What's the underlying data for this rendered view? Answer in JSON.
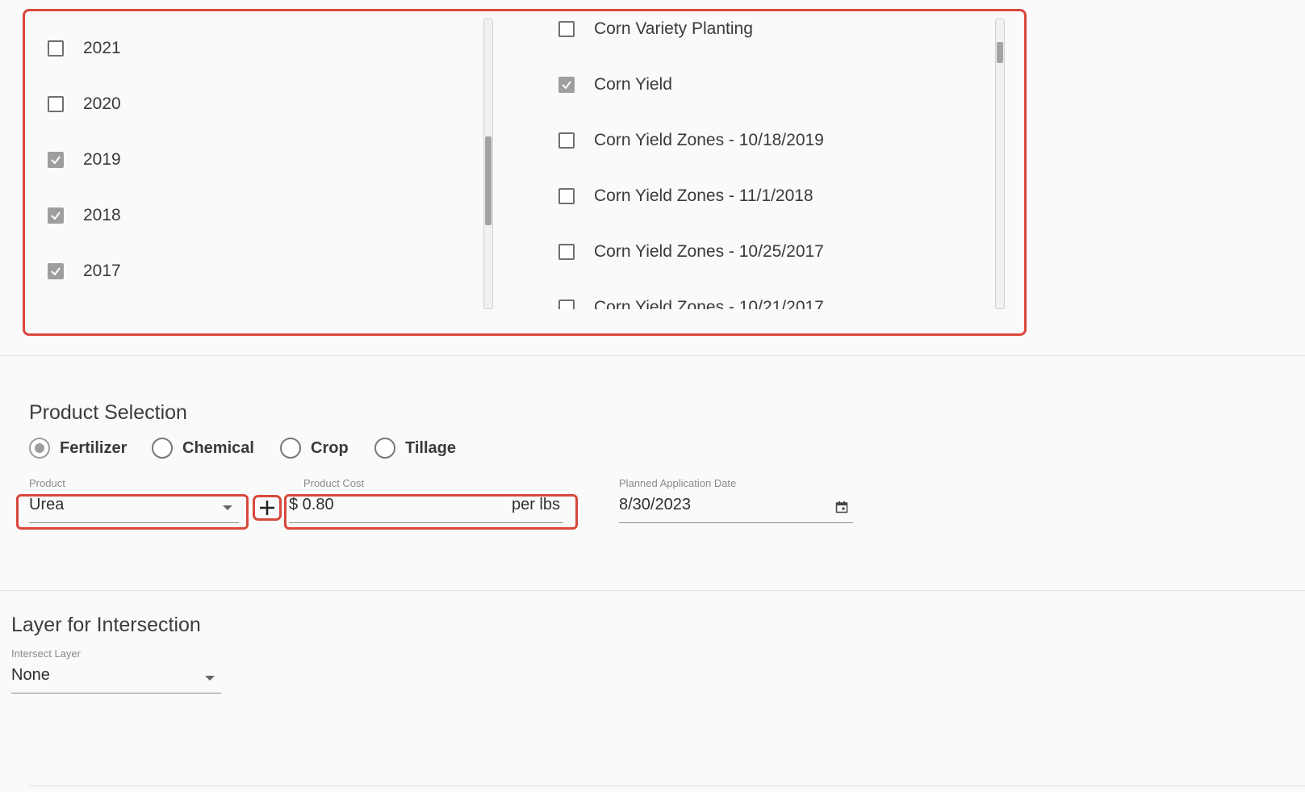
{
  "years": [
    {
      "label": "2021",
      "checked": false
    },
    {
      "label": "2020",
      "checked": false
    },
    {
      "label": "2019",
      "checked": true
    },
    {
      "label": "2018",
      "checked": true
    },
    {
      "label": "2017",
      "checked": true
    }
  ],
  "layers": [
    {
      "label": "Corn Variety Planting",
      "checked": false
    },
    {
      "label": "Corn Yield",
      "checked": true
    },
    {
      "label": "Corn Yield Zones - 10/18/2019",
      "checked": false
    },
    {
      "label": "Corn Yield Zones - 11/1/2018",
      "checked": false
    },
    {
      "label": "Corn Yield Zones - 10/25/2017",
      "checked": false
    },
    {
      "label": "Corn Yield Zones - 10/21/2017",
      "checked": false
    }
  ],
  "product_selection": {
    "title": "Product Selection",
    "types": [
      {
        "label": "Fertilizer",
        "selected": true
      },
      {
        "label": "Chemical",
        "selected": false
      },
      {
        "label": "Crop",
        "selected": false
      },
      {
        "label": "Tillage",
        "selected": false
      }
    ],
    "product": {
      "label": "Product",
      "value": "Urea"
    },
    "add_icon": "plus-icon",
    "cost": {
      "label": "Product Cost",
      "value": "$ 0.80",
      "unit": "per lbs"
    },
    "date": {
      "label": "Planned Application Date",
      "value": "8/30/2023",
      "icon": "calendar-icon"
    }
  },
  "intersection": {
    "title": "Layer for Intersection",
    "field_label": "Intersect Layer",
    "value": "None"
  },
  "colors": {
    "highlight": "#d9483b",
    "checked": "#9e9e9e"
  }
}
